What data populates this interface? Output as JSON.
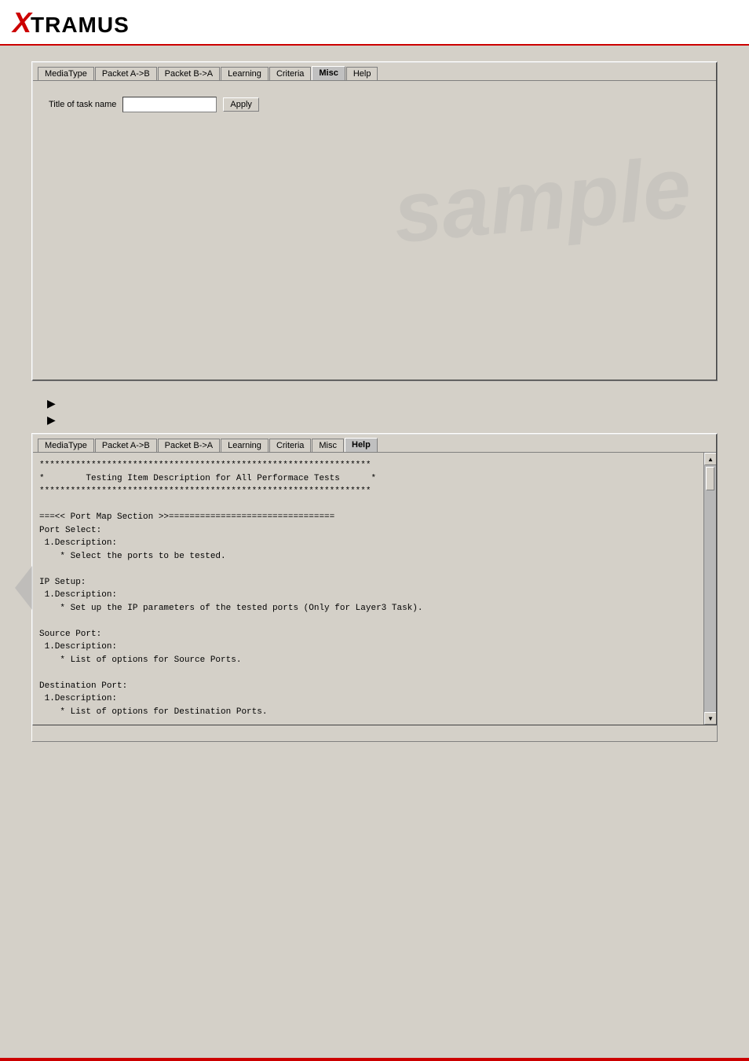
{
  "header": {
    "logo_x": "X",
    "logo_rest": "TRAMUS"
  },
  "top_panel": {
    "tabs": [
      {
        "id": "mediatype",
        "label": "MediaType",
        "active": false
      },
      {
        "id": "packet_atob",
        "label": "Packet A->B",
        "active": false
      },
      {
        "id": "packet_btoa",
        "label": "Packet B->A",
        "active": false
      },
      {
        "id": "learning",
        "label": "Learning",
        "active": false
      },
      {
        "id": "criteria",
        "label": "Criteria",
        "active": false
      },
      {
        "id": "misc",
        "label": "Misc",
        "active": true
      },
      {
        "id": "help",
        "label": "Help",
        "active": false
      }
    ],
    "task_label": "Title of task name",
    "apply_button": "Apply",
    "task_input_value": ""
  },
  "arrows": [
    {
      "symbol": "▶"
    },
    {
      "symbol": "▶"
    }
  ],
  "bottom_panel": {
    "tabs": [
      {
        "id": "mediatype",
        "label": "MediaType",
        "active": false
      },
      {
        "id": "packet_atob",
        "label": "Packet A->B",
        "active": false
      },
      {
        "id": "packet_btoa",
        "label": "Packet B->A",
        "active": false
      },
      {
        "id": "learning",
        "label": "Learning",
        "active": false
      },
      {
        "id": "criteria",
        "label": "Criteria",
        "active": false
      },
      {
        "id": "misc",
        "label": "Misc",
        "active": false
      },
      {
        "id": "help",
        "label": "Help",
        "active": true
      }
    ],
    "help_text_lines": [
      "****************************************************************",
      "*        Testing Item Description for All Performace Tests      *",
      "****************************************************************",
      "",
      "===<< Port Map Section >>================================",
      "Port Select:",
      " 1.Description:",
      "    * Select the ports to be tested.",
      "",
      "IP Setup:",
      " 1.Description:",
      "    * Set up the IP parameters of the tested ports (Only for Layer3 Task).",
      "",
      "Source Port:",
      " 1.Description:",
      "    * List of options for Source Ports.",
      "",
      "Destination Port:",
      " 1.Description:",
      "    * List of options for Destination Ports."
    ]
  },
  "watermark": {
    "text": "sample",
    "color": "rgba(160,160,160,0.25)"
  },
  "footer": {
    "color": "#cc0000"
  }
}
